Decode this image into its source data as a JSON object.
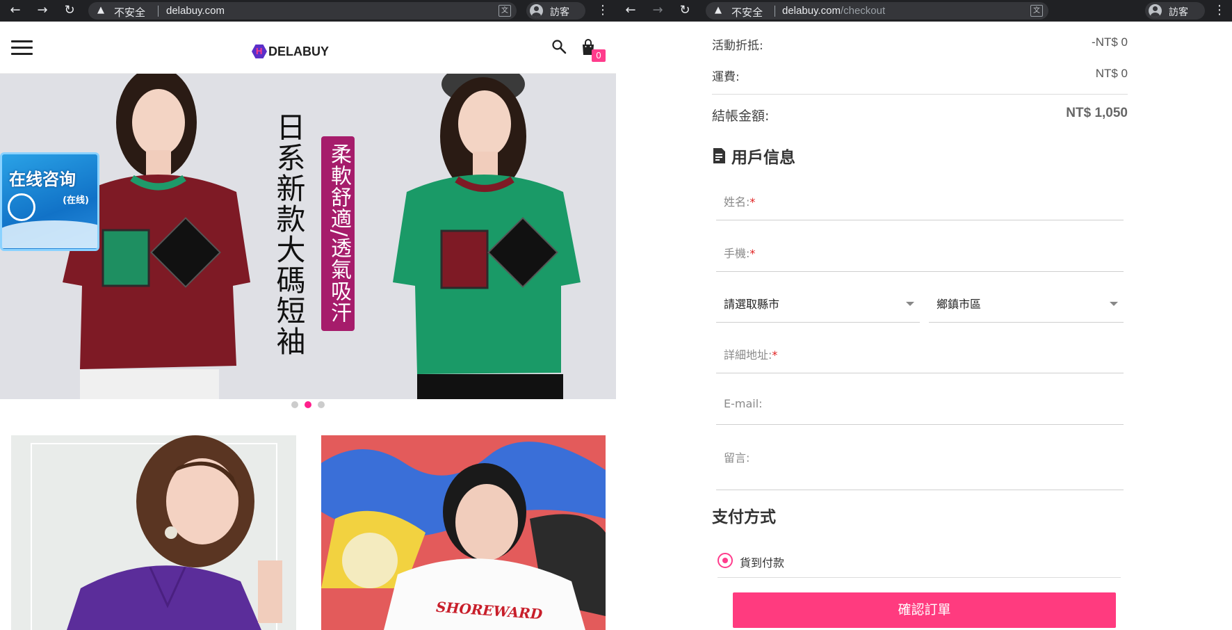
{
  "left_browser": {
    "security_label": "不安全",
    "url_host": "delabuy.com",
    "url_path": "",
    "profile_name": "訪客"
  },
  "right_browser": {
    "security_label": "不安全",
    "url_host": "delabuy.com",
    "url_path": "/checkout",
    "profile_name": "訪客"
  },
  "site": {
    "logo_text": "DELABUY",
    "cart_count": "0",
    "banner": {
      "headline": "日系新款大碼短袖",
      "tagline": "柔軟舒適/透氣吸汗",
      "active_slide": 2,
      "slide_count": 3
    },
    "chat_widget": {
      "title": "在线咨询",
      "status": "(在线)"
    },
    "product_tile_text": "SHOREWARD"
  },
  "checkout": {
    "summary": [
      {
        "label": "活動折抵:",
        "value": "-NT$ 0"
      },
      {
        "label": "運費:",
        "value": "NT$ 0"
      }
    ],
    "total_label": "結帳金額:",
    "total_value": "NT$ 1,050",
    "user_info_title": "用戶信息",
    "fields": {
      "name": "姓名:",
      "phone": "手機:",
      "county_select": "請選取縣市",
      "district_select": "鄉鎮市區",
      "address": "詳細地址:",
      "email": "E-mail:",
      "message": "留言:"
    },
    "required_mark": "*",
    "payment_title": "支付方式",
    "payment_option": "貨到付款",
    "confirm_label": "確認訂單"
  },
  "colors": {
    "accent": "#ff3b7f",
    "chrome_bg": "#202124",
    "banner_tag": "#a61c6b"
  }
}
